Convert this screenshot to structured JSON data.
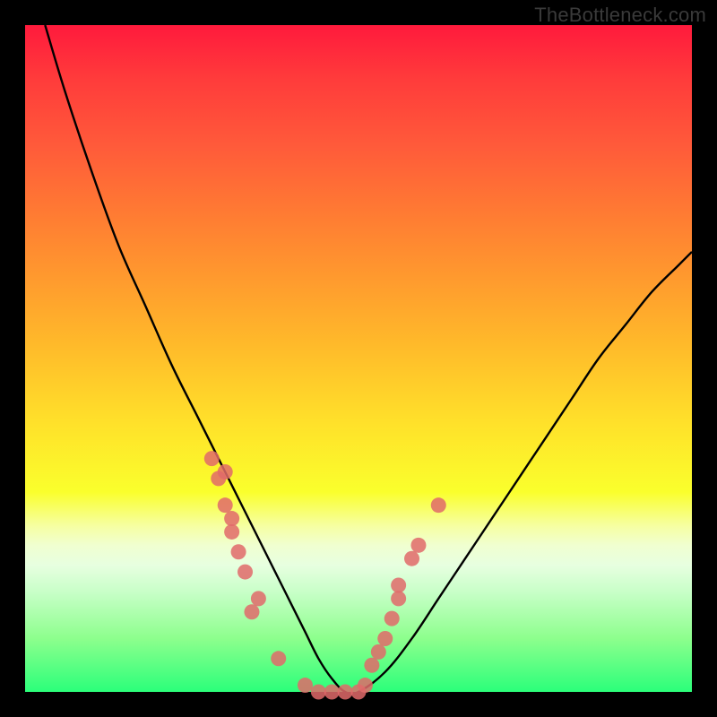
{
  "watermark": "TheBottleneck.com",
  "chart_data": {
    "type": "line",
    "title": "",
    "xlabel": "",
    "ylabel": "",
    "xlim": [
      0,
      100
    ],
    "ylim": [
      0,
      100
    ],
    "grid": false,
    "legend": false,
    "series": [
      {
        "name": "curve",
        "color": "#000000",
        "x": [
          3,
          6,
          10,
          14,
          18,
          22,
          26,
          30,
          32,
          34,
          36,
          38,
          40,
          42,
          44,
          46,
          48,
          50,
          54,
          58,
          62,
          66,
          70,
          74,
          78,
          82,
          86,
          90,
          94,
          98,
          100
        ],
        "y": [
          100,
          90,
          78,
          67,
          58,
          49,
          41,
          33,
          29,
          25,
          21,
          17,
          13,
          9,
          5,
          2,
          0,
          0,
          3,
          8,
          14,
          20,
          26,
          32,
          38,
          44,
          50,
          55,
          60,
          64,
          66
        ]
      }
    ],
    "markers": [
      {
        "name": "left-cluster",
        "color": "#e06a6a",
        "points_xy": [
          [
            28,
            35
          ],
          [
            30,
            33
          ],
          [
            29,
            32
          ],
          [
            30,
            28
          ],
          [
            31,
            26
          ],
          [
            31,
            24
          ],
          [
            32,
            21
          ],
          [
            33,
            18
          ],
          [
            35,
            14
          ],
          [
            34,
            12
          ]
        ]
      },
      {
        "name": "flat-cluster",
        "color": "#e06a6a",
        "points_xy": [
          [
            38,
            5
          ],
          [
            42,
            1
          ],
          [
            44,
            0
          ],
          [
            46,
            0
          ],
          [
            48,
            0
          ],
          [
            50,
            0
          ],
          [
            51,
            1
          ]
        ]
      },
      {
        "name": "right-cluster",
        "color": "#e06a6a",
        "points_xy": [
          [
            52,
            4
          ],
          [
            53,
            6
          ],
          [
            54,
            8
          ],
          [
            55,
            11
          ],
          [
            56,
            14
          ],
          [
            56,
            16
          ],
          [
            58,
            20
          ],
          [
            59,
            22
          ],
          [
            62,
            28
          ]
        ]
      }
    ]
  }
}
